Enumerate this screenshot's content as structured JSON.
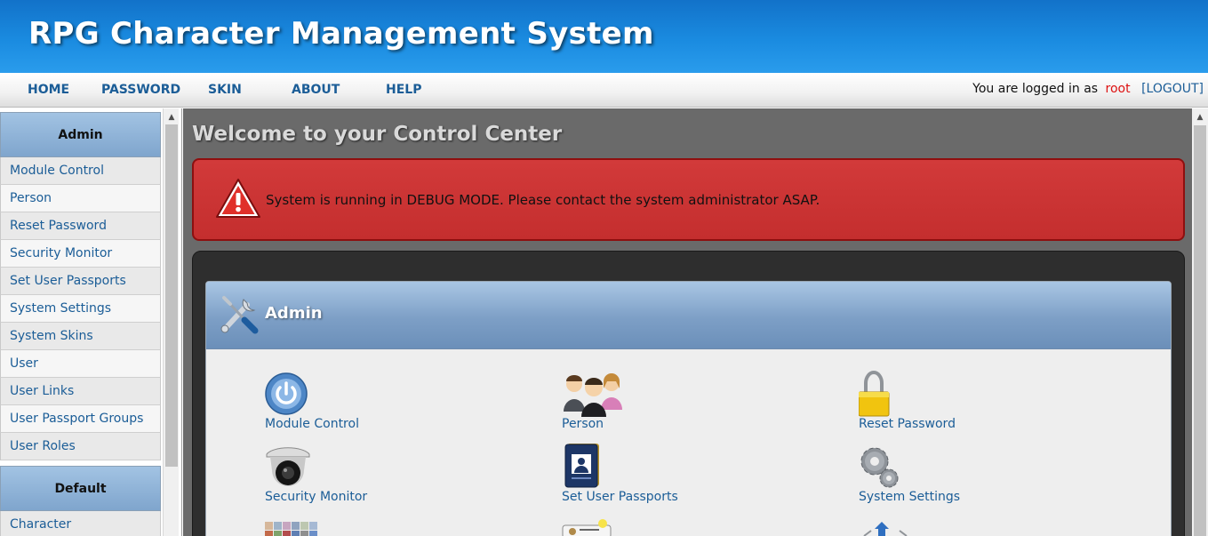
{
  "app": {
    "title": "RPG Character Management System"
  },
  "nav": {
    "items": [
      {
        "label": "HOME"
      },
      {
        "label": "PASSWORD"
      },
      {
        "label": "SKIN"
      },
      {
        "label": "ABOUT"
      },
      {
        "label": "HELP"
      }
    ],
    "login_prefix": "You are logged in as",
    "username": "root",
    "logout_label": "[LOGOUT]"
  },
  "sidebar": {
    "admin": {
      "title": "Admin",
      "items": [
        {
          "label": "Module Control"
        },
        {
          "label": "Person"
        },
        {
          "label": "Reset Password"
        },
        {
          "label": "Security Monitor"
        },
        {
          "label": "Set User Passports"
        },
        {
          "label": "System Settings"
        },
        {
          "label": "System Skins"
        },
        {
          "label": "User"
        },
        {
          "label": "User Links"
        },
        {
          "label": "User Passport Groups"
        },
        {
          "label": "User Roles"
        }
      ]
    },
    "default": {
      "title": "Default",
      "items": [
        {
          "label": "Character"
        }
      ]
    }
  },
  "main": {
    "title": "Welcome to your Control Center",
    "alert": {
      "text": "System is running in DEBUG MODE. Please contact the system administrator ASAP."
    },
    "section": {
      "title": "Admin",
      "tiles": [
        {
          "label": "Module Control",
          "icon": "power-icon"
        },
        {
          "label": "Person",
          "icon": "people-icon"
        },
        {
          "label": "Reset Password",
          "icon": "padlock-icon"
        },
        {
          "label": "Security Monitor",
          "icon": "security-camera-icon"
        },
        {
          "label": "Set User Passports",
          "icon": "passport-icon"
        },
        {
          "label": "System Settings",
          "icon": "gears-icon"
        }
      ]
    }
  },
  "colors": {
    "header_blue": "#1a8be0",
    "link_blue": "#1b5d97",
    "alert_red": "#c83434",
    "username_red": "#dd1111"
  }
}
